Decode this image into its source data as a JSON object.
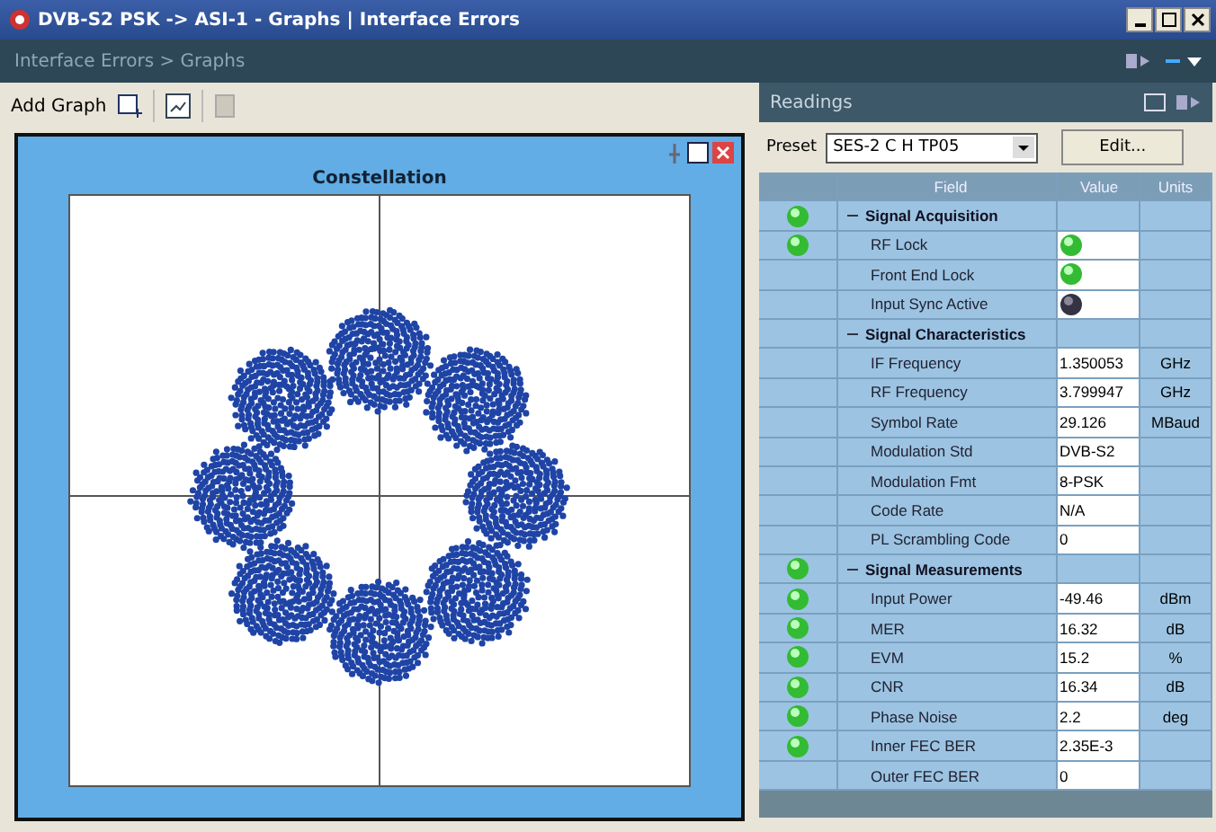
{
  "window": {
    "title": "DVB-S2 PSK -> ASI-1 - Graphs | Interface Errors"
  },
  "breadcrumb": "Interface Errors > Graphs",
  "toolbar": {
    "add_graph": "Add Graph"
  },
  "graph": {
    "title": "Constellation"
  },
  "readings": {
    "title": "Readings",
    "preset_label": "Preset",
    "preset_value": "SES-2 C H TP05",
    "edit_button": "Edit...",
    "columns": [
      "Field",
      "Value",
      "Units"
    ],
    "rows": [
      {
        "kind": "group",
        "field": "Signal Acquisition",
        "indicator": true,
        "expanded": true
      },
      {
        "kind": "led",
        "field": "RF Lock",
        "indicator": true,
        "led_on": true
      },
      {
        "kind": "led",
        "field": "Front End Lock",
        "indicator": false,
        "led_on": true
      },
      {
        "kind": "led",
        "field": "Input Sync Active",
        "indicator": false,
        "led_on": false
      },
      {
        "kind": "group",
        "field": "Signal Characteristics",
        "indicator": false,
        "expanded": true
      },
      {
        "kind": "value",
        "field": "IF Frequency",
        "indicator": false,
        "value": "1.350053",
        "units": "GHz"
      },
      {
        "kind": "value",
        "field": "RF Frequency",
        "indicator": false,
        "value": "3.799947",
        "units": "GHz"
      },
      {
        "kind": "value",
        "field": "Symbol Rate",
        "indicator": false,
        "value": "29.126",
        "units": "MBaud"
      },
      {
        "kind": "value",
        "field": "Modulation Std",
        "indicator": false,
        "value": "DVB-S2"
      },
      {
        "kind": "value",
        "field": "Modulation Fmt",
        "indicator": false,
        "value": "8-PSK"
      },
      {
        "kind": "value",
        "field": "Code Rate",
        "indicator": false,
        "value": "N/A"
      },
      {
        "kind": "value",
        "field": "PL Scrambling Code",
        "indicator": false,
        "value": "0"
      },
      {
        "kind": "group",
        "field": "Signal Measurements",
        "indicator": true,
        "expanded": true
      },
      {
        "kind": "value",
        "field": "Input Power",
        "indicator": true,
        "value": "-49.46",
        "units": "dBm"
      },
      {
        "kind": "value",
        "field": "MER",
        "indicator": true,
        "value": "16.32",
        "units": "dB"
      },
      {
        "kind": "value",
        "field": "EVM",
        "indicator": true,
        "value": "15.2",
        "units": "%"
      },
      {
        "kind": "value",
        "field": "CNR",
        "indicator": true,
        "value": "16.34",
        "units": "dB"
      },
      {
        "kind": "value",
        "field": "Phase Noise",
        "indicator": true,
        "value": "2.2",
        "units": "deg"
      },
      {
        "kind": "value",
        "field": "Inner FEC BER",
        "indicator": true,
        "value": "2.35E-3"
      },
      {
        "kind": "value",
        "field": "Outer FEC BER",
        "indicator": false,
        "value": "0"
      }
    ]
  }
}
